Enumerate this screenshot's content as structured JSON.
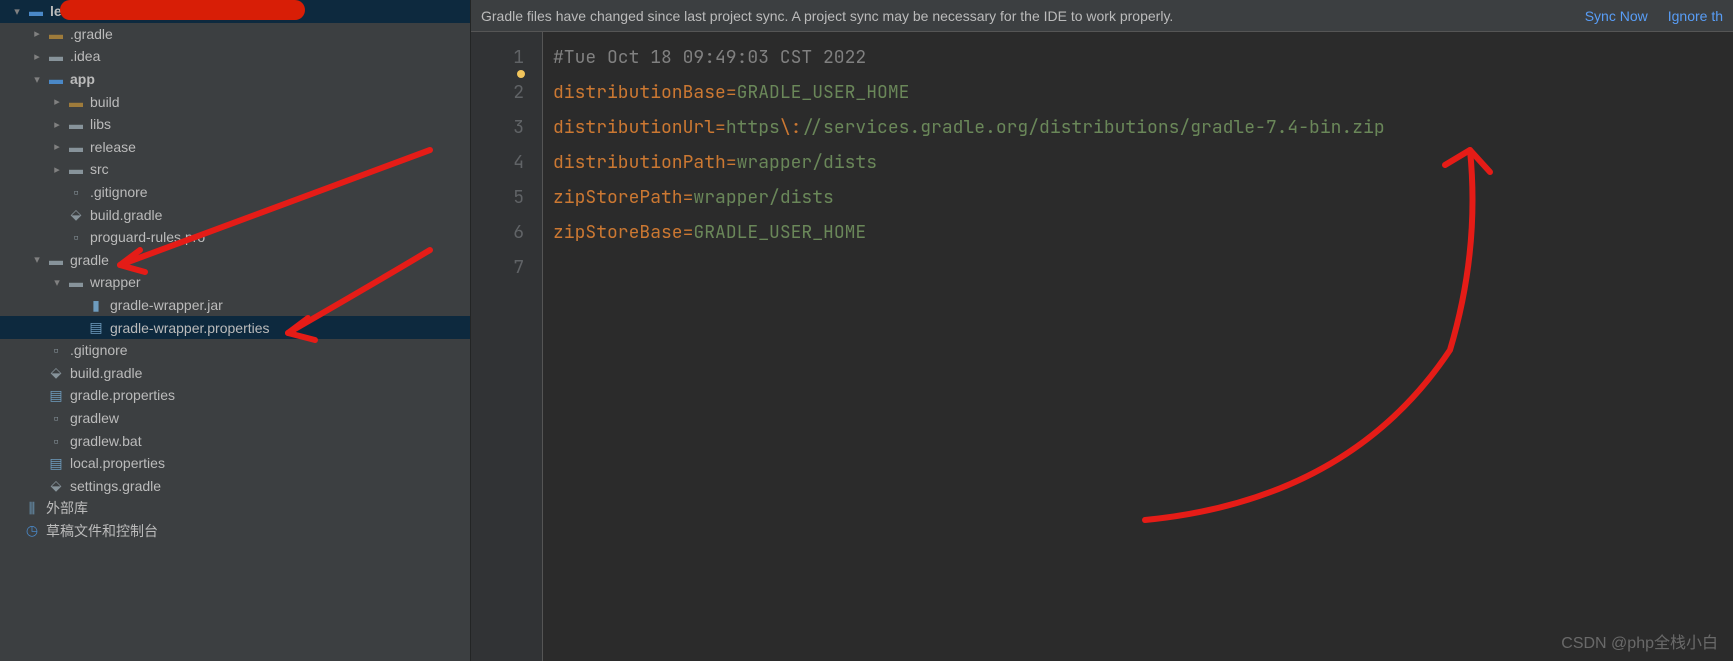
{
  "project": {
    "root": "lemon"
  },
  "tree": [
    {
      "indent": 0,
      "arrow": "down",
      "iconType": "folder-blue",
      "label": "lemon",
      "bold": true
    },
    {
      "indent": 1,
      "arrow": "right",
      "iconType": "folder-orange",
      "label": ".gradle"
    },
    {
      "indent": 1,
      "arrow": "right",
      "iconType": "folder",
      "label": ".idea"
    },
    {
      "indent": 1,
      "arrow": "down",
      "iconType": "folder-blue",
      "label": "app",
      "bold": true
    },
    {
      "indent": 2,
      "arrow": "right",
      "iconType": "folder-orange",
      "label": "build"
    },
    {
      "indent": 2,
      "arrow": "right",
      "iconType": "folder",
      "label": "libs"
    },
    {
      "indent": 2,
      "arrow": "right",
      "iconType": "folder",
      "label": "release"
    },
    {
      "indent": 2,
      "arrow": "right",
      "iconType": "folder",
      "label": "src"
    },
    {
      "indent": 2,
      "arrow": "",
      "iconType": "file",
      "label": ".gitignore"
    },
    {
      "indent": 2,
      "arrow": "",
      "iconType": "gradle",
      "label": "build.gradle"
    },
    {
      "indent": 2,
      "arrow": "",
      "iconType": "file",
      "label": "proguard-rules.pro"
    },
    {
      "indent": 1,
      "arrow": "down",
      "iconType": "folder",
      "label": "gradle"
    },
    {
      "indent": 2,
      "arrow": "down",
      "iconType": "folder",
      "label": "wrapper"
    },
    {
      "indent": 3,
      "arrow": "",
      "iconType": "jar",
      "label": "gradle-wrapper.jar"
    },
    {
      "indent": 3,
      "arrow": "",
      "iconType": "prop",
      "label": "gradle-wrapper.properties",
      "selected": true
    },
    {
      "indent": 1,
      "arrow": "",
      "iconType": "file",
      "label": ".gitignore"
    },
    {
      "indent": 1,
      "arrow": "",
      "iconType": "gradle",
      "label": "build.gradle"
    },
    {
      "indent": 1,
      "arrow": "",
      "iconType": "prop",
      "label": "gradle.properties"
    },
    {
      "indent": 1,
      "arrow": "",
      "iconType": "file",
      "label": "gradlew"
    },
    {
      "indent": 1,
      "arrow": "",
      "iconType": "file",
      "label": "gradlew.bat"
    },
    {
      "indent": 1,
      "arrow": "",
      "iconType": "prop",
      "label": "local.properties"
    },
    {
      "indent": 1,
      "arrow": "",
      "iconType": "gradle",
      "label": "settings.gradle"
    },
    {
      "indent": -1,
      "arrow": "",
      "iconType": "lib",
      "label": "外部库"
    },
    {
      "indent": -1,
      "arrow": "",
      "iconType": "scratch",
      "label": "草稿文件和控制台"
    }
  ],
  "notification": {
    "message": "Gradle files have changed since last project sync. A project sync may be necessary for the IDE to work properly.",
    "action1": "Sync Now",
    "action2": "Ignore th"
  },
  "gutter_lines": [
    "1",
    "2",
    "3",
    "4",
    "5",
    "6",
    "7"
  ],
  "code": {
    "l1_comment": "#Tue Oct 18 09:49:03 CST 2022",
    "l2_key": "distributionBase",
    "l2_val": "GRADLE_USER_HOME",
    "l3_key": "distributionUrl",
    "l3_v1": "https",
    "l3_esc": "\\:",
    "l3_v2": "//services.gradle.org/distributions/gradle-7.4-bin.zip",
    "l4_key": "distributionPath",
    "l4_val": "wrapper/dists",
    "l5_key": "zipStorePath",
    "l5_val": "wrapper/dists",
    "l6_key": "zipStoreBase",
    "l6_val": "GRADLE_USER_HOME"
  },
  "watermark": "CSDN @php全栈小白"
}
